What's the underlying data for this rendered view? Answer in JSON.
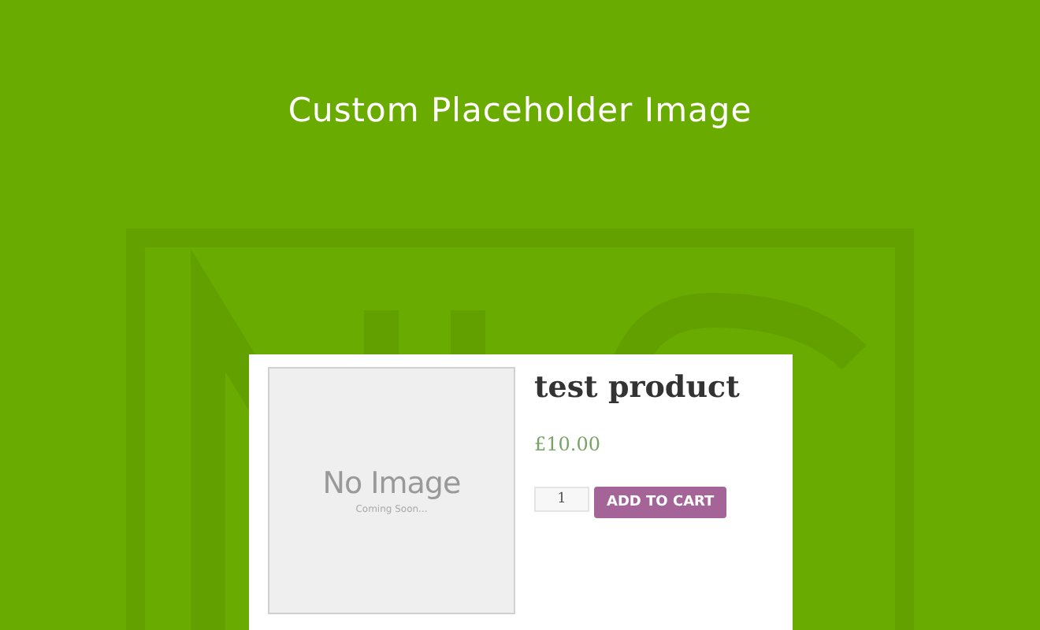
{
  "banner": {
    "title": "Custom Placeholder Image"
  },
  "product": {
    "image": {
      "title": "No Image",
      "subtitle": "Coming Soon..."
    },
    "name": "test product",
    "price": "£10.00",
    "quantity": "1",
    "button": "ADD TO CART"
  }
}
